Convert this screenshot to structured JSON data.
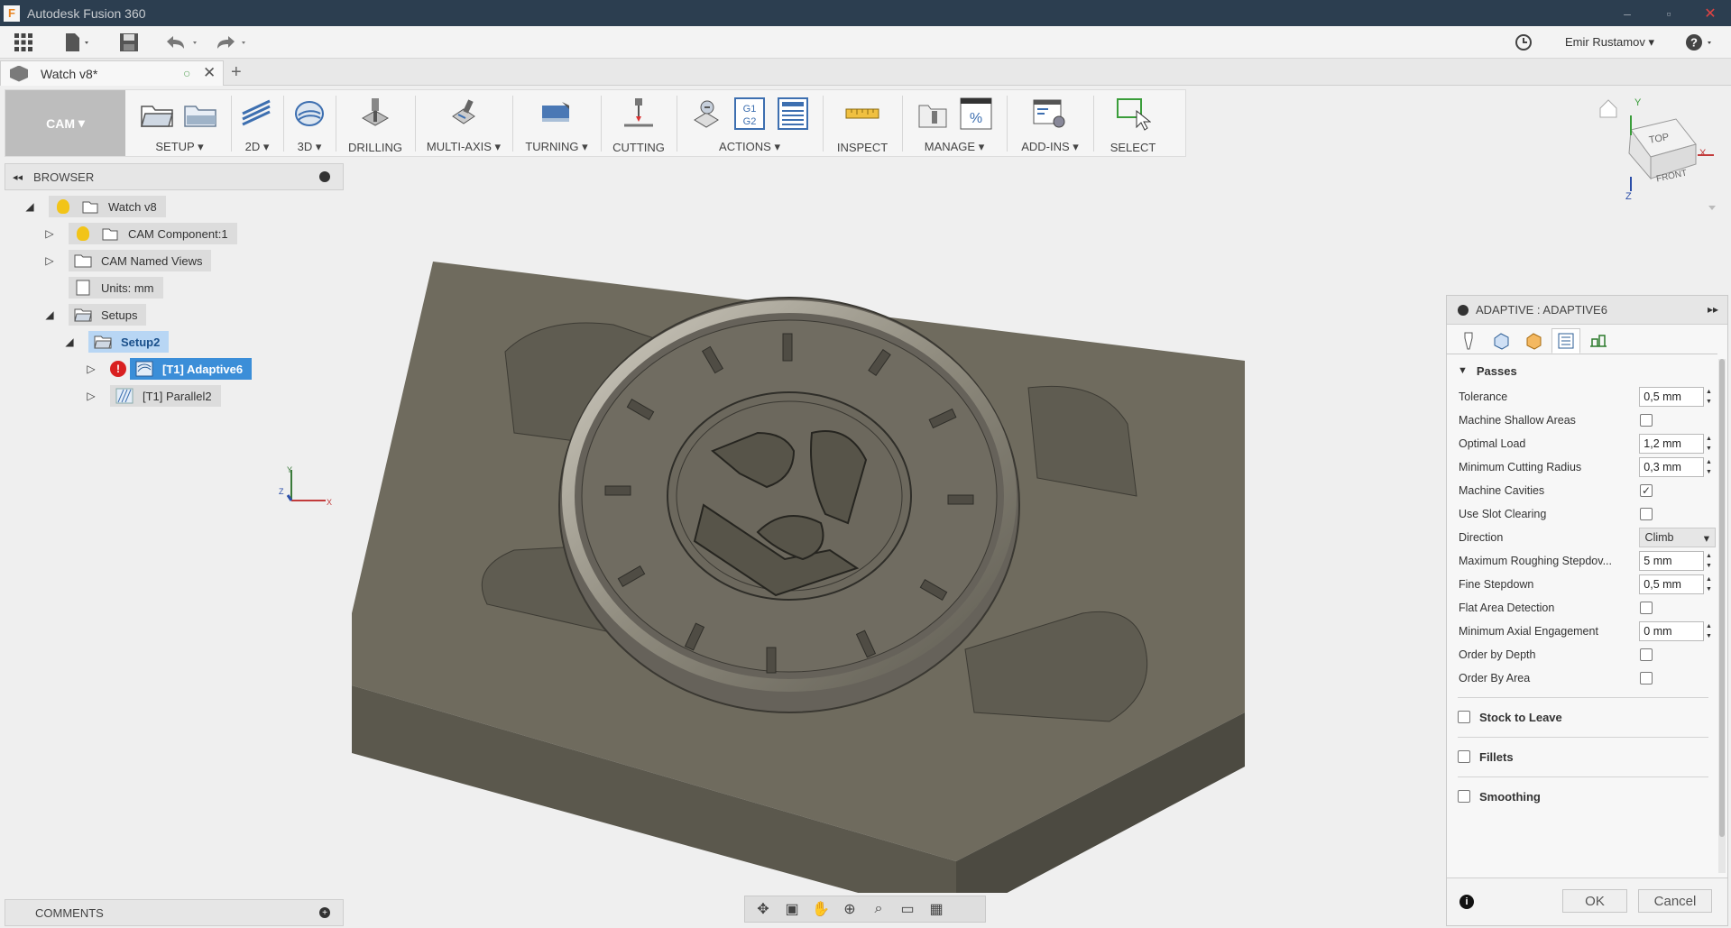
{
  "window": {
    "title": "Autodesk Fusion 360"
  },
  "quick_access": {
    "user_name": "Emir Rustamov"
  },
  "document_tab": {
    "title": "Watch v8*"
  },
  "ribbon": {
    "workspace": "CAM",
    "groups": [
      {
        "label": "SETUP",
        "dropdown": true
      },
      {
        "label": "2D",
        "dropdown": true
      },
      {
        "label": "3D",
        "dropdown": true
      },
      {
        "label": "DRILLING",
        "dropdown": false
      },
      {
        "label": "MULTI-AXIS",
        "dropdown": true
      },
      {
        "label": "TURNING",
        "dropdown": true
      },
      {
        "label": "CUTTING",
        "dropdown": false
      },
      {
        "label": "ACTIONS",
        "dropdown": true
      },
      {
        "label": "INSPECT",
        "dropdown": false
      },
      {
        "label": "MANAGE",
        "dropdown": true
      },
      {
        "label": "ADD-INS",
        "dropdown": true
      },
      {
        "label": "SELECT",
        "dropdown": false
      }
    ]
  },
  "browser": {
    "title": "BROWSER",
    "tree": [
      {
        "label": "Watch v8"
      },
      {
        "label": "CAM Component:1"
      },
      {
        "label": "CAM Named Views"
      },
      {
        "label": "Units: mm"
      },
      {
        "label": "Setups"
      },
      {
        "label": "Setup2"
      },
      {
        "label": "[T1] Adaptive6"
      },
      {
        "label": "[T1] Parallel2"
      }
    ]
  },
  "comments": {
    "title": "COMMENTS"
  },
  "viewcube": {
    "top": "TOP",
    "front": "FRONT",
    "axis_x": "X",
    "axis_y": "Y",
    "axis_z": "Z"
  },
  "triad": {
    "x": "X",
    "y": "Y",
    "z": "Z"
  },
  "dialog": {
    "title": "ADAPTIVE : ADAPTIVE6",
    "sections": {
      "passes": "Passes",
      "stock_to_leave": "Stock to Leave",
      "fillets": "Fillets",
      "smoothing": "Smoothing"
    },
    "params": [
      {
        "label": "Tolerance",
        "type": "number",
        "value": "0,5 mm"
      },
      {
        "label": "Machine Shallow Areas",
        "type": "checkbox",
        "checked": false
      },
      {
        "label": "Optimal Load",
        "type": "number",
        "value": "1,2 mm"
      },
      {
        "label": "Minimum Cutting Radius",
        "type": "number",
        "value": "0,3 mm"
      },
      {
        "label": "Machine Cavities",
        "type": "checkbox",
        "checked": true
      },
      {
        "label": "Use Slot Clearing",
        "type": "checkbox",
        "checked": false
      },
      {
        "label": "Direction",
        "type": "select",
        "value": "Climb"
      },
      {
        "label": "Maximum Roughing Stepdov...",
        "type": "number",
        "value": "5 mm"
      },
      {
        "label": "Fine Stepdown",
        "type": "number",
        "value": "0,5 mm"
      },
      {
        "label": "Flat Area Detection",
        "type": "checkbox",
        "checked": false
      },
      {
        "label": "Minimum Axial Engagement",
        "type": "number",
        "value": "0 mm"
      },
      {
        "label": "Order by Depth",
        "type": "checkbox",
        "checked": false
      },
      {
        "label": "Order By Area",
        "type": "checkbox",
        "checked": false
      }
    ],
    "ok_label": "OK",
    "cancel_label": "Cancel",
    "check_mark": "✓"
  },
  "colors": {
    "selected": "#3b8ed8",
    "model": "#6b6758",
    "titlebar": "#2c3e50"
  }
}
